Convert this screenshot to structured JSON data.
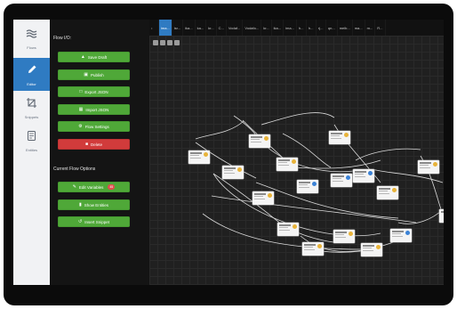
{
  "sidebar": {
    "items": [
      {
        "label": "Flows",
        "icon": "waves-icon"
      },
      {
        "label": "Editor",
        "icon": "pencil-icon",
        "active": true
      },
      {
        "label": "Snippets",
        "icon": "crop-icon"
      },
      {
        "label": "Entities",
        "icon": "document-icon"
      }
    ]
  },
  "panel": {
    "flow_io_title": "Flow I/O:",
    "save_draft": "Save Draft",
    "publish": "Publish",
    "export_json": "Export JSON",
    "import_json": "Import JSON",
    "flow_settings": "Flow Settings",
    "delete": "Delete",
    "current_options_title": "Current Flow Options",
    "edit_variables": "Edit Variables",
    "variables_count": "45",
    "show_entities": "Show Entities",
    "insert_snippet": "Insert Snippet"
  },
  "tabs": {
    "first": "•",
    "items": [
      "ima...",
      "lsr...",
      "ika...",
      "ka...",
      "kr...",
      "C...",
      "Vodaf...",
      "Vodafo...",
      "kr...",
      "ika...",
      "ima...",
      "h...",
      "h...",
      "rj...",
      "qn...",
      "melb...",
      "ma...",
      "m...",
      "R..."
    ]
  },
  "colors": {
    "accent": "#2f7bc2",
    "button_green": "#4fa838",
    "button_red": "#d13b3b"
  }
}
